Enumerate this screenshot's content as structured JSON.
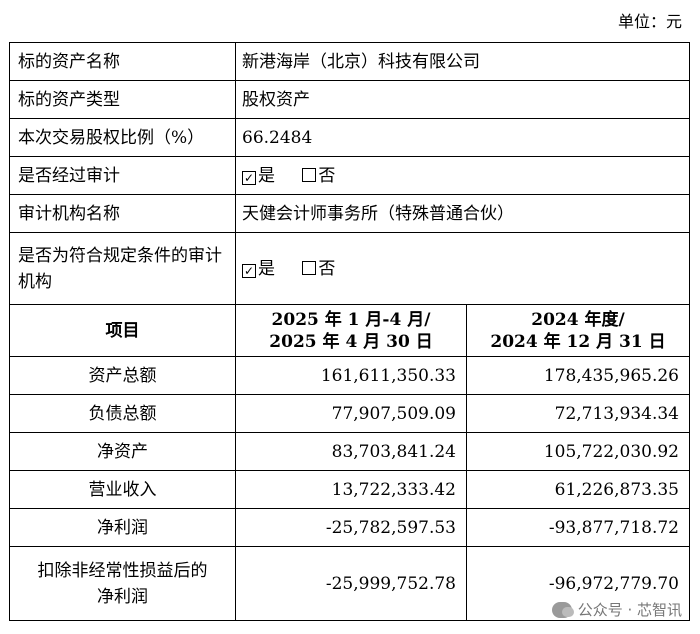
{
  "unit_label": "单位：元",
  "info_rows": [
    {
      "label": "标的资产名称",
      "value": "新港海岸（北京）科技有限公司"
    },
    {
      "label": "标的资产类型",
      "value": "股权资产"
    },
    {
      "label": "本次交易股权比例（%）",
      "value": "66.2484"
    }
  ],
  "audited": {
    "label": "是否经过审计",
    "yes": "是",
    "no": "否",
    "yes_checked": true,
    "no_checked": false
  },
  "audit_firm": {
    "label": "审计机构名称",
    "value": "天健会计师事务所（特殊普通合伙）"
  },
  "qualified": {
    "label": "是否为符合规定条件的审计机构",
    "yes": "是",
    "no": "否",
    "yes_checked": true,
    "no_checked": false
  },
  "fin_header": {
    "item": "项目",
    "col1_line1": "2025 年 1 月-4 月/",
    "col1_line2": "2025 年 4 月 30 日",
    "col2_line1": "2024 年度/",
    "col2_line2": "2024 年 12 月 31 日"
  },
  "fin_rows": [
    {
      "item": "资产总额",
      "v1": "161,611,350.33",
      "v2": "178,435,965.26"
    },
    {
      "item": "负债总额",
      "v1": "77,907,509.09",
      "v2": "72,713,934.34"
    },
    {
      "item": "净资产",
      "v1": "83,703,841.24",
      "v2": "105,722,030.92"
    },
    {
      "item": "营业收入",
      "v1": "13,722,333.42",
      "v2": "61,226,873.35"
    },
    {
      "item": "净利润",
      "v1": "-25,782,597.53",
      "v2": "-93,877,718.72"
    },
    {
      "item": "扣除非经常性损益后的净利润",
      "v1": "-25,999,752.78",
      "v2": "-96,972,779.70"
    }
  ],
  "watermark": "公众号 · 芯智讯"
}
